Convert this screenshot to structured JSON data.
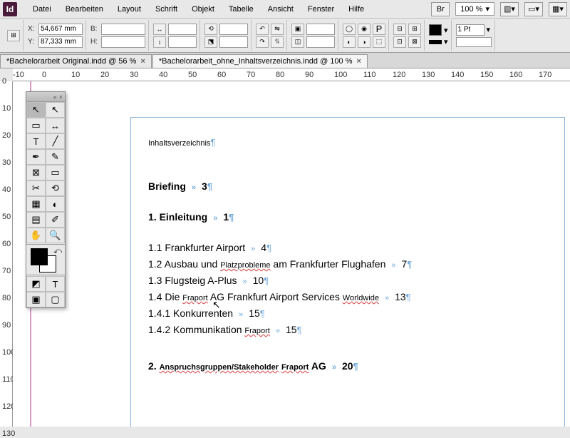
{
  "app": {
    "icon": "Id"
  },
  "menu": [
    "Datei",
    "Bearbeiten",
    "Layout",
    "Schrift",
    "Objekt",
    "Tabelle",
    "Ansicht",
    "Fenster",
    "Hilfe"
  ],
  "zoom": "100 %",
  "coords": {
    "x": "54,667 mm",
    "y": "87,333 mm",
    "b": "",
    "h": ""
  },
  "stroke_weight": "1 Pt",
  "tabs": [
    {
      "label": "*Bachelorarbeit Original.indd @ 56 %",
      "active": false
    },
    {
      "label": "*Bachelorarbeit_ohne_Inhaltsverzeichnis.indd @ 100 %",
      "active": true
    }
  ],
  "hruler_marks": [
    -10,
    0,
    10,
    20,
    30,
    40,
    50,
    60,
    70,
    80,
    90,
    100,
    110,
    120,
    130,
    140,
    150,
    160,
    170
  ],
  "vruler_marks": [
    0,
    10,
    20,
    30,
    40,
    50,
    60,
    70,
    80,
    90,
    100,
    110,
    120,
    130
  ],
  "doc": {
    "title": "Inhaltsverzeichnis",
    "lines": [
      {
        "style": "bold",
        "text": "Briefing",
        "page": "3"
      },
      {
        "style": "bold",
        "text": "1. Einleitung",
        "page": "1"
      },
      {
        "style": "",
        "text": "1.1 Frankfurter Airport",
        "page": "4"
      },
      {
        "style": "",
        "pre": "1.2 Ausbau und ",
        "u": "Platzprobleme",
        "post": " am Frankfurter Flughafen",
        "page": "7"
      },
      {
        "style": "",
        "text": "1.3 Flugsteig A-Plus",
        "page": "10"
      },
      {
        "style": "",
        "pre": "1.4 Die ",
        "u": "Fraport",
        "post": " AG Frankfurt Airport Services ",
        "u2": "Worldwide",
        "page": "13"
      },
      {
        "style": "",
        "text": "1.4.1 Konkurrenten",
        "page": "15"
      },
      {
        "style": "",
        "pre": "1.4.2 Kommunikation ",
        "u": "Fraport",
        "post": "",
        "page": "15"
      },
      {
        "style": "h2",
        "pre": "2. ",
        "u": "Anspruchsgruppen/Stakeholder",
        "post": " ",
        "u2": "Fraport",
        "post2": " AG",
        "page": "20"
      }
    ]
  },
  "tools": [
    [
      "selection",
      "↖",
      "direct-select",
      "↖"
    ],
    [
      "page",
      "▭",
      "gap",
      "↔"
    ],
    [
      "type",
      "T",
      "line",
      "╱"
    ],
    [
      "pen",
      "✒",
      "pencil",
      "✎"
    ],
    [
      "rect-frame",
      "⊠",
      "rectangle",
      "▭"
    ],
    [
      "scissors",
      "✂",
      "transform",
      "⟲"
    ],
    [
      "gradient-swatch",
      "▦",
      "gradient-feather",
      "◐"
    ],
    [
      "note",
      "▤",
      "eyedropper",
      "✐"
    ],
    [
      "hand",
      "✋",
      "zoom",
      "🔍"
    ]
  ],
  "tool_modes": [
    [
      "fill-mode",
      "◩",
      "text-mode",
      "T"
    ],
    [
      "normal-view",
      "▣",
      "preview",
      "▢"
    ]
  ]
}
